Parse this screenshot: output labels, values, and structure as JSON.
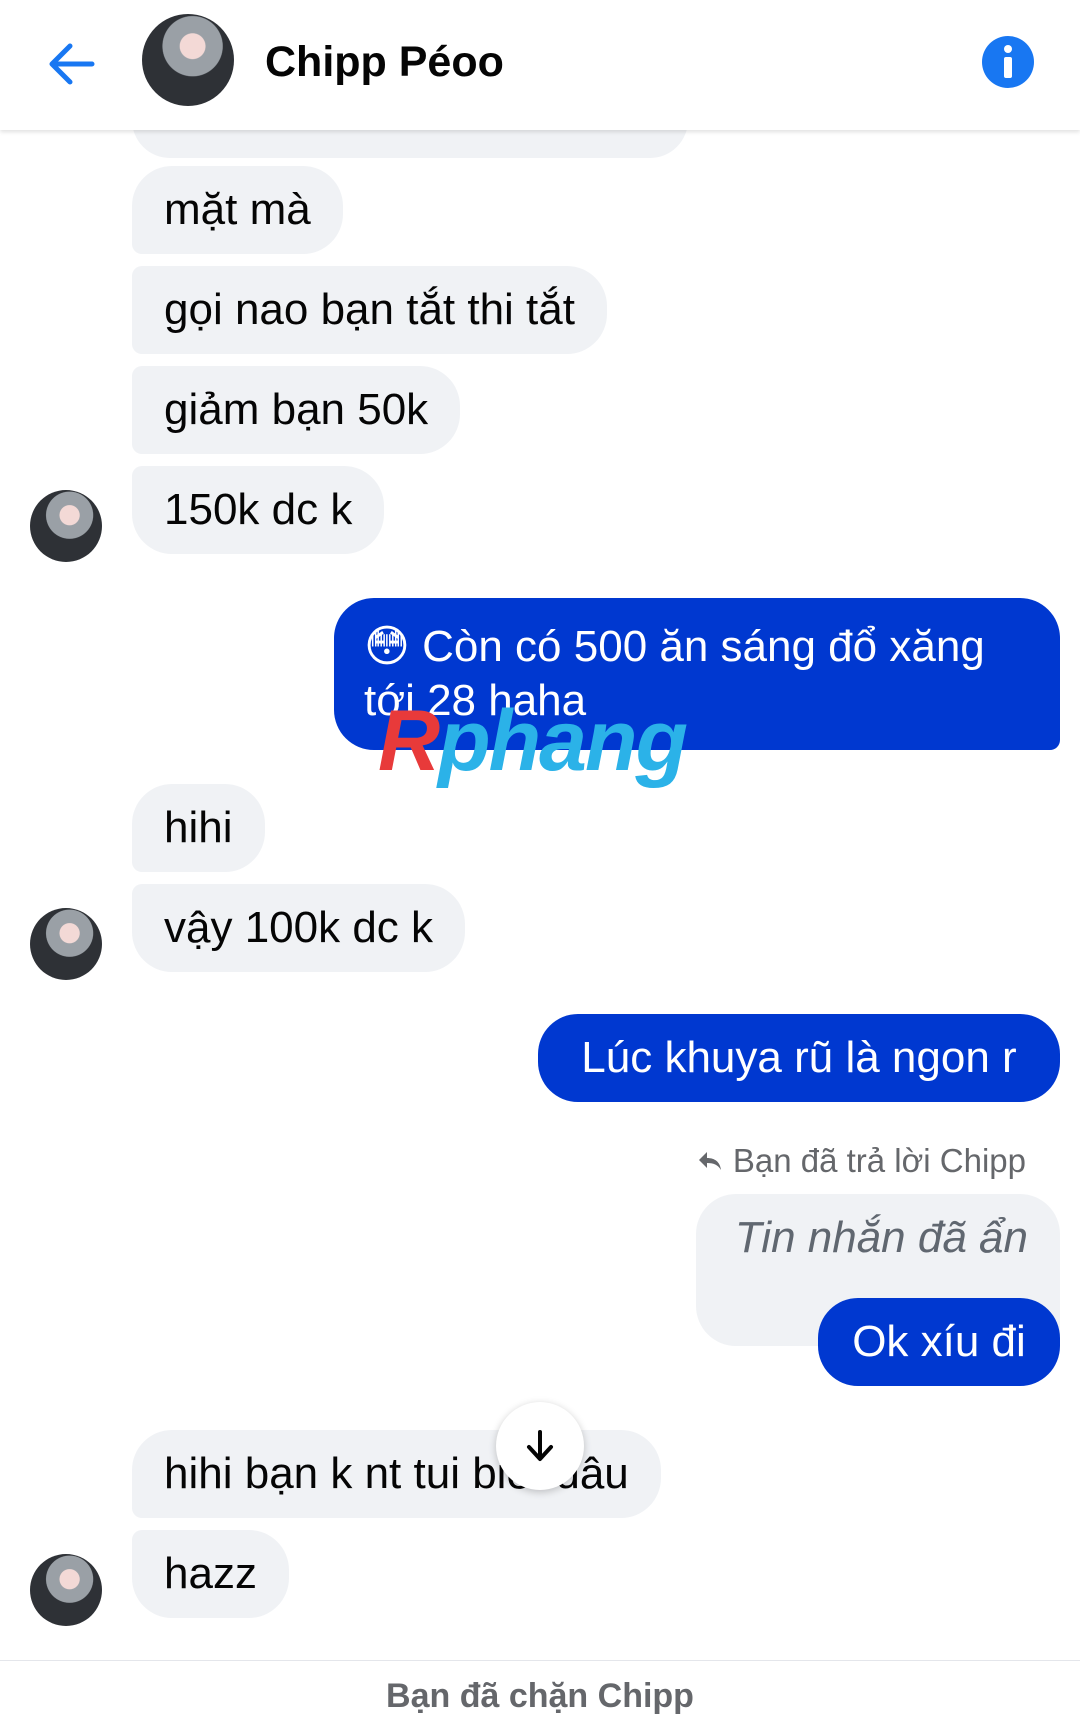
{
  "header": {
    "contact_name": "Chipp Péoo",
    "back_icon": "arrow-left-icon",
    "info_icon": "info-icon",
    "accent_color": "#1877f2"
  },
  "messages": [
    {
      "from": "them",
      "text": "mặt mà"
    },
    {
      "from": "them",
      "text": "gọi nao bạn tắt thi tắt"
    },
    {
      "from": "them",
      "text": "giảm bạn 50k"
    },
    {
      "from": "them",
      "text": "150k dc k"
    },
    {
      "from": "me",
      "emoji": "😳",
      "line1": "Còn có 500 ăn sáng đổ xăng",
      "line2": "tới 28 haha"
    },
    {
      "from": "them",
      "text": "hihi"
    },
    {
      "from": "them",
      "text": "vậy 100k dc k"
    },
    {
      "from": "me",
      "text": "Lúc khuya rũ là ngon r"
    },
    {
      "from": "me",
      "reply_note": "Bạn đã trả lời Chipp",
      "quoted": "Tin nhắn đã ẩn",
      "text": "Ok xíu đi"
    },
    {
      "from": "them",
      "text": "hihi bạn k nt tui biết dâu"
    },
    {
      "from": "them",
      "text": "hazz"
    }
  ],
  "watermark": {
    "text_part1": "R",
    "text_part2": "phang",
    "color1": "#e83a3a",
    "color2": "#2bb2e8"
  },
  "scroll_button_icon": "arrow-down-icon",
  "footer": {
    "blocked_text": "Bạn đã chặn Chipp"
  },
  "colors": {
    "sent_bubble": "#0038d0",
    "received_bubble": "#f0f2f5"
  }
}
